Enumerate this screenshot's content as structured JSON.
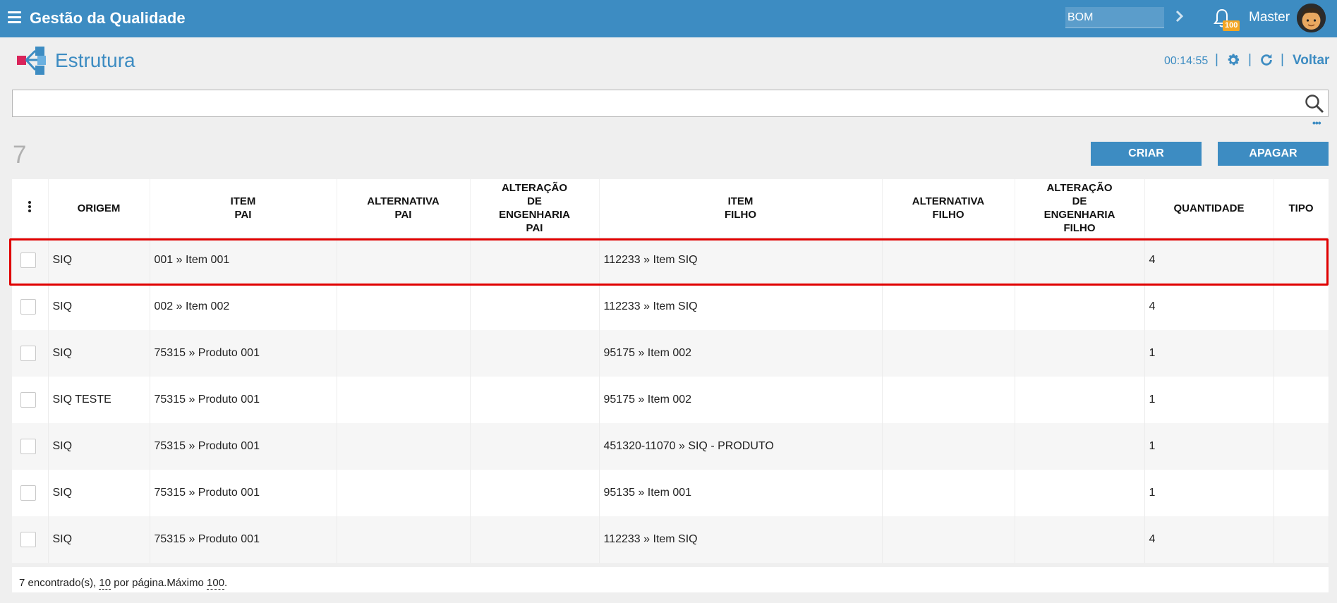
{
  "topbar": {
    "app_title": "Gestão da Qualidade",
    "bom_value": "BOM",
    "notification_count": "100",
    "user_name": "Master"
  },
  "header": {
    "page_title": "Estrutura",
    "timer": "00:14:55",
    "back_label": "Voltar"
  },
  "toolbar": {
    "record_count": "7",
    "create_label": "CRIAR",
    "delete_label": "APAGAR"
  },
  "table": {
    "columns": [
      [
        "ORIGEM"
      ],
      [
        "ITEM",
        "PAI"
      ],
      [
        "ALTERNATIVA",
        "PAI"
      ],
      [
        "ALTERAÇÃO",
        "DE",
        "ENGENHARIA",
        "PAI"
      ],
      [
        "ITEM",
        "FILHO"
      ],
      [
        "ALTERNATIVA",
        "FILHO"
      ],
      [
        "ALTERAÇÃO",
        "DE",
        "ENGENHARIA",
        "FILHO"
      ],
      [
        "QUANTIDADE"
      ],
      [
        "TIPO"
      ]
    ],
    "rows": [
      [
        "SIQ",
        "001 » Item 001",
        "",
        "",
        "112233 » Item SIQ",
        "",
        "",
        "4",
        ""
      ],
      [
        "SIQ",
        "002 » Item 002",
        "",
        "",
        "112233 » Item SIQ",
        "",
        "",
        "4",
        ""
      ],
      [
        "SIQ",
        "75315 » Produto 001",
        "",
        "",
        "95175 » Item 002",
        "",
        "",
        "1",
        ""
      ],
      [
        "SIQ TESTE",
        "75315 » Produto 001",
        "",
        "",
        "95175 » Item 002",
        "",
        "",
        "1",
        ""
      ],
      [
        "SIQ",
        "75315 » Produto 001",
        "",
        "",
        "451320-11070 » SIQ - PRODUTO",
        "",
        "",
        "1",
        ""
      ],
      [
        "SIQ",
        "75315 » Produto 001",
        "",
        "",
        "95135 » Item 001",
        "",
        "",
        "1",
        ""
      ],
      [
        "SIQ",
        "75315 » Produto 001",
        "",
        "",
        "112233 » Item SIQ",
        "",
        "",
        "4",
        ""
      ]
    ]
  },
  "footer": {
    "found_text": "7 encontrado(s),",
    "per_page_value": "10",
    "per_page_text": "por página.Máximo",
    "max_value": "100",
    "end_text": "."
  },
  "colors": {
    "primary": "#3d8cc2",
    "badge": "#f5a623",
    "highlight": "#e00000"
  }
}
